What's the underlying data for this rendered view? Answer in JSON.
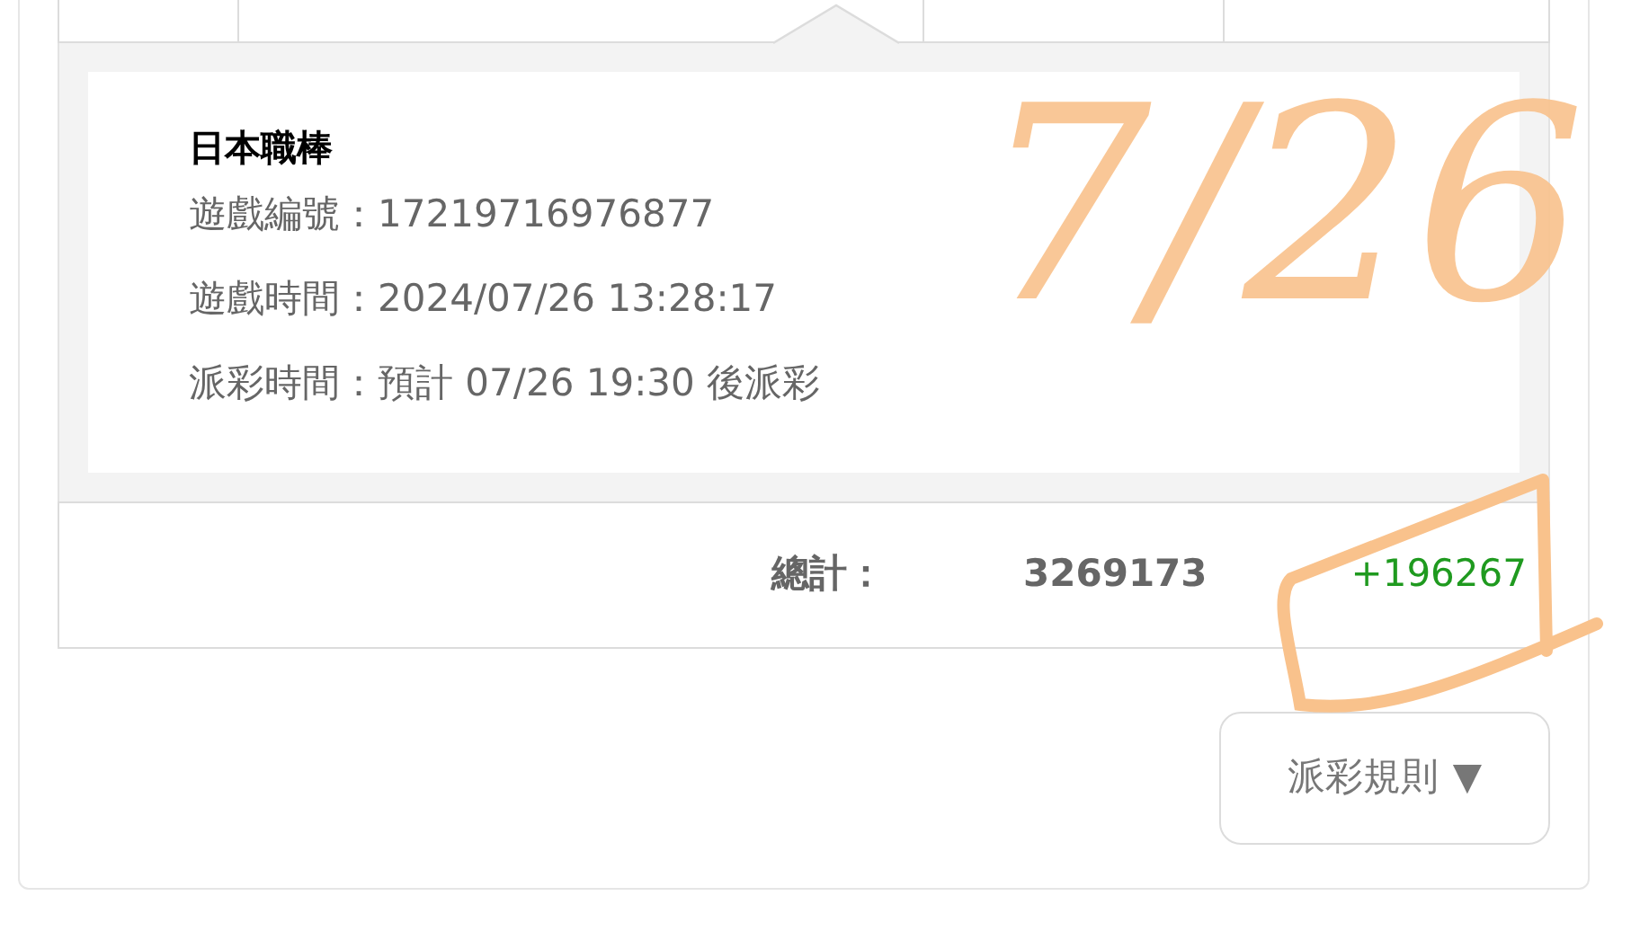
{
  "detail": {
    "title": "日本職棒",
    "lines": [
      {
        "label": "遊戲編號：",
        "value": "17219716976877"
      },
      {
        "label": "遊戲時間：",
        "value": "2024/07/26 13:28:17"
      },
      {
        "label": "派彩時間：",
        "value": "預計 07/26 19:30 後派彩"
      }
    ]
  },
  "total": {
    "label": "總計：",
    "amount": "3269173",
    "profit": "+196267"
  },
  "rules_button": {
    "label": "派彩規則",
    "caret": "▼"
  },
  "annotation": {
    "text": "7/26"
  }
}
